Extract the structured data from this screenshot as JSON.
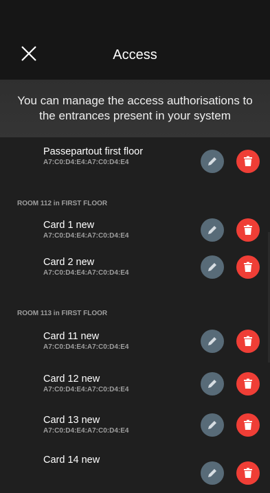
{
  "header": {
    "title": "Access"
  },
  "notice": "You can manage the access authorisations to the entrances present in your system",
  "list": {
    "top_item": {
      "name": "Passepartout first floor",
      "code": "A7:C0:D4:E4:A7:C0:D4:E4"
    },
    "sections": [
      {
        "title": "ROOM 112 in FIRST FLOOR",
        "items": [
          {
            "name": "Card 1 new",
            "code": "A7:C0:D4:E4:A7:C0:D4:E4"
          },
          {
            "name": "Card 2 new",
            "code": "A7:C0:D4:E4:A7:C0:D4:E4"
          }
        ]
      },
      {
        "title": "ROOM 113 in FIRST FLOOR",
        "items": [
          {
            "name": "Card 11 new",
            "code": "A7:C0:D4:E4:A7:C0:D4:E4"
          },
          {
            "name": "Card 12 new",
            "code": "A7:C0:D4:E4:A7:C0:D4:E4"
          },
          {
            "name": "Card 13 new",
            "code": "A7:C0:D4:E4:A7:C0:D4:E4"
          },
          {
            "name": "Card 14 new",
            "code": ""
          }
        ]
      }
    ]
  },
  "icons": {
    "close": "close-icon",
    "edit": "pencil-icon",
    "delete": "trash-icon"
  },
  "colors": {
    "edit_button": "#586b78",
    "delete_button": "#ef3e36",
    "background": "#1f1f1f"
  }
}
